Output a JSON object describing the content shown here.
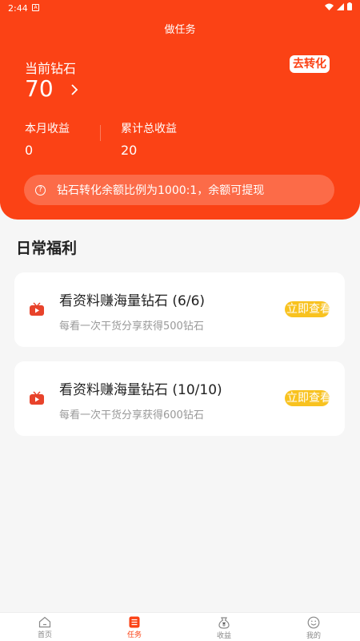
{
  "status": {
    "time": "2:44",
    "notification": "A"
  },
  "header": {
    "title": "做任务",
    "diamond_label": "当前钻石",
    "diamond_value": "70",
    "convert_button": "去转化",
    "month_label": "本月收益",
    "month_value": "0",
    "total_label": "累计总收益",
    "total_value": "20",
    "notice": "钻石转化余额比例为1000:1，余额可提现"
  },
  "section": {
    "title": "日常福利"
  },
  "tasks": [
    {
      "title": "看资料赚海量钻石 (6/6)",
      "desc": "每看一次干货分享获得500钻石",
      "button": "立即查看",
      "icon": "video-play-icon"
    },
    {
      "title": "看资料赚海量钻石 (10/10)",
      "desc": "每看一次干货分享获得600钻石",
      "button": "立即查看",
      "icon": "video-play-icon"
    }
  ],
  "tabs": [
    {
      "label": "首页",
      "icon": "home-icon"
    },
    {
      "label": "任务",
      "icon": "task-list-icon",
      "active": true
    },
    {
      "label": "收益",
      "icon": "money-bag-icon"
    },
    {
      "label": "我的",
      "icon": "smile-face-icon"
    }
  ],
  "colors": {
    "primary": "#fb4215",
    "button": "#f8c21f",
    "background": "#f6f6f6"
  }
}
